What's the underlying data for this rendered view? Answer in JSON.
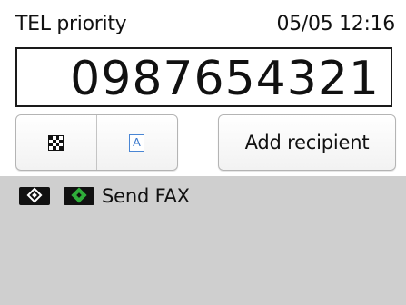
{
  "header": {
    "mode_label": "TEL priority",
    "datetime": "05/05 12:16"
  },
  "number_display": {
    "value": "0987654321"
  },
  "buttons": {
    "mono_icon": "checkered-icon",
    "color_icon": "letter-a-icon",
    "color_icon_text": "A",
    "add_recipient_label": "Add recipient"
  },
  "start_hint": {
    "black_key_icon": "black-start-icon",
    "color_key_icon": "color-start-icon",
    "label": "Send FAX"
  },
  "colors": {
    "panel_gray": "#cfcfcf",
    "start_green": "#2fae3a",
    "accent_blue": "#3a78cc"
  }
}
